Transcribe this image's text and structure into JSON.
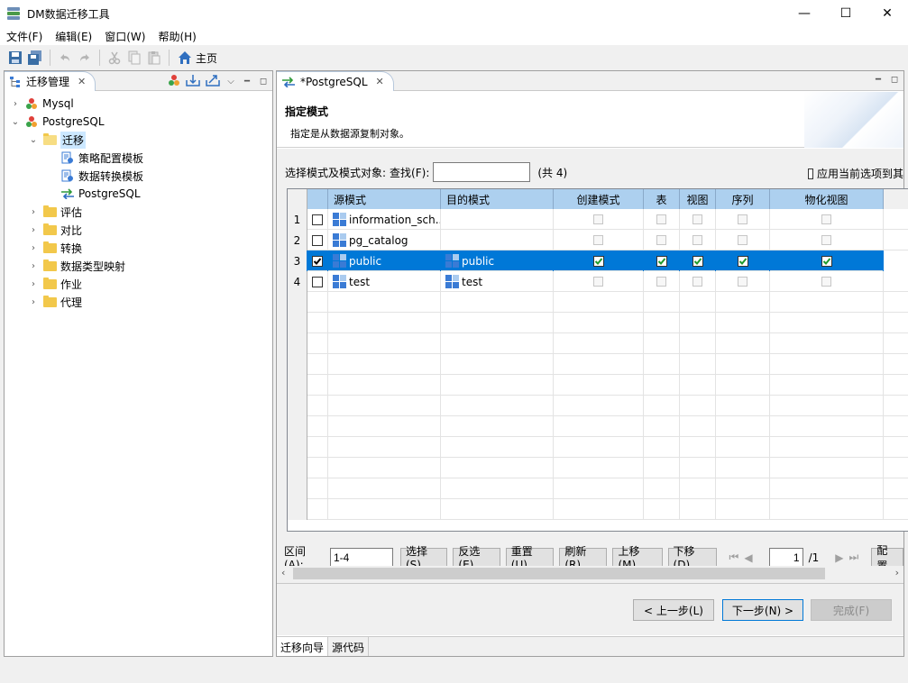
{
  "window": {
    "title": "DM数据迁移工具",
    "minimize": "—",
    "maximize": "☐",
    "close": "✕"
  },
  "menu": [
    "文件(F)",
    "编辑(E)",
    "窗口(W)",
    "帮助(H)"
  ],
  "toolbar": {
    "home_label": "主页"
  },
  "left_panel": {
    "tab_label": "迁移管理",
    "tree": [
      {
        "label": "Mysql",
        "level": 0,
        "expanded": false,
        "icon": "db-icon"
      },
      {
        "label": "PostgreSQL",
        "level": 0,
        "expanded": true,
        "icon": "db-icon"
      },
      {
        "label": "迁移",
        "level": 1,
        "expanded": true,
        "icon": "folder-open-icon",
        "selected": true
      },
      {
        "label": "策略配置模板",
        "level": 2,
        "icon": "template-icon"
      },
      {
        "label": "数据转换模板",
        "level": 2,
        "icon": "template-icon"
      },
      {
        "label": "PostgreSQL",
        "level": 2,
        "icon": "migrate-arrows-icon"
      },
      {
        "label": "评估",
        "level": 1,
        "expanded": false,
        "icon": "folder-icon"
      },
      {
        "label": "对比",
        "level": 1,
        "expanded": false,
        "icon": "folder-icon"
      },
      {
        "label": "转换",
        "level": 1,
        "expanded": false,
        "icon": "folder-icon"
      },
      {
        "label": "数据类型映射",
        "level": 1,
        "expanded": false,
        "icon": "folder-icon"
      },
      {
        "label": "作业",
        "level": 1,
        "expanded": false,
        "icon": "folder-icon"
      },
      {
        "label": "代理",
        "level": 1,
        "expanded": false,
        "icon": "folder-icon"
      }
    ]
  },
  "right_panel": {
    "tab_label": "*PostgreSQL",
    "header": {
      "title": "指定模式",
      "subtitle": "指定是从数据源复制对象。"
    },
    "filter": {
      "label": "选择模式及模式对象:",
      "search_label": "查找(F):",
      "search_value": "",
      "count": "(共 4)",
      "apply_label": "应用当前选项到其"
    },
    "table": {
      "columns": [
        "源模式",
        "目的模式",
        "创建模式",
        "表",
        "视图",
        "序列",
        "物化视图"
      ],
      "rows": [
        {
          "num": "1",
          "checked": false,
          "source": "information_sch...",
          "target": "",
          "flags": [
            false,
            false,
            false,
            false,
            false
          ]
        },
        {
          "num": "2",
          "checked": false,
          "source": "pg_catalog",
          "target": "",
          "flags": [
            false,
            false,
            false,
            false,
            false
          ]
        },
        {
          "num": "3",
          "checked": true,
          "source": "public",
          "target": "public",
          "flags": [
            true,
            true,
            true,
            true,
            true
          ],
          "selected": true
        },
        {
          "num": "4",
          "checked": false,
          "source": "test",
          "target": "test",
          "flags": [
            false,
            false,
            false,
            false,
            false
          ]
        }
      ]
    },
    "pager": {
      "range_label": "区间(A):",
      "range_value": "1-4",
      "select": "选择(S)",
      "invert": "反选(E)",
      "reset": "重置(U)",
      "refresh": "刷新(R)",
      "up": "上移(M)",
      "down": "下移(D)",
      "page_value": "1",
      "page_total": "/1",
      "config": "配置"
    },
    "footer": {
      "prev": "< 上一步(L)",
      "next": "下一步(N) >",
      "finish": "完成(F)"
    },
    "bottom_tabs": [
      "迁移向导",
      "源代码"
    ]
  }
}
